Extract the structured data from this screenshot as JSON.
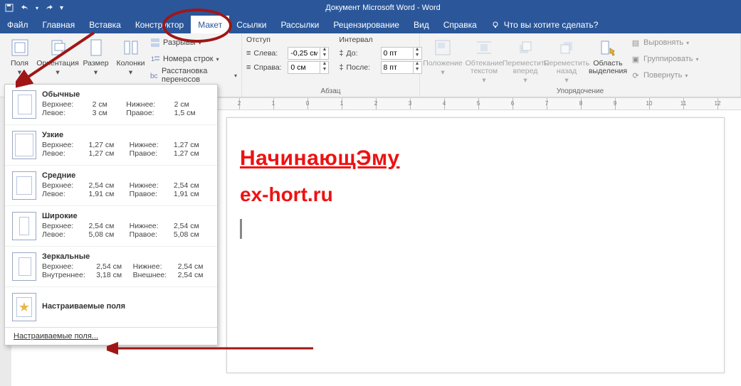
{
  "title": "Документ Microsoft Word  -  Word",
  "qat": {
    "save": "save-icon",
    "undo": "undo-icon",
    "redo": "redo-icon",
    "more": "more-icon"
  },
  "tabs": [
    "Файл",
    "Главная",
    "Вставка",
    "Конструктор",
    "Макет",
    "Ссылки",
    "Рассылки",
    "Рецензирование",
    "Вид",
    "Справка"
  ],
  "active_tab": "Макет",
  "tell_me": "Что вы хотите сделать?",
  "ribbon": {
    "page_setup": {
      "margins": "Поля",
      "orientation": "Ориентация",
      "size": "Размер",
      "columns": "Колонки",
      "breaks": "Разрывы",
      "line_numbers": "Номера строк",
      "hyphenation": "Расстановка переносов"
    },
    "paragraph": {
      "indent_label": "Отступ",
      "spacing_label": "Интервал",
      "left_label": "Слева:",
      "right_label": "Справа:",
      "before_label": "До:",
      "after_label": "После:",
      "left_value": "-0,25 см",
      "right_value": "0 см",
      "before_value": "0 пт",
      "after_value": "8 пт",
      "group_label": "Абзац"
    },
    "arrange": {
      "position": "Положение",
      "wrap": "Обтекание текстом",
      "forward": "Переместить вперед",
      "backward": "Переместить назад",
      "selection_pane": "Область выделения",
      "align": "Выровнять",
      "group": "Группировать",
      "rotate": "Повернуть",
      "group_label": "Упорядочение"
    }
  },
  "margins_menu": {
    "options": [
      {
        "title": "Обычные",
        "top": "2 см",
        "bottom": "2 см",
        "left": "3 см",
        "right": "1,5 см",
        "lk": "Левое:",
        "rk": "Правое:"
      },
      {
        "title": "Узкие",
        "top": "1,27 см",
        "bottom": "1,27 см",
        "left": "1,27 см",
        "right": "1,27 см",
        "lk": "Левое:",
        "rk": "Правое:"
      },
      {
        "title": "Средние",
        "top": "2,54 см",
        "bottom": "2,54 см",
        "left": "1,91 см",
        "right": "1,91 см",
        "lk": "Левое:",
        "rk": "Правое:"
      },
      {
        "title": "Широкие",
        "top": "2,54 см",
        "bottom": "2,54 см",
        "left": "5,08 см",
        "right": "5,08 см",
        "lk": "Левое:",
        "rk": "Правое:"
      },
      {
        "title": "Зеркальные",
        "top": "2,54 см",
        "bottom": "2,54 см",
        "left": "3,18 см",
        "right": "2,54 см",
        "lk": "Внутреннее:",
        "rk": "Внешнее:"
      }
    ],
    "labels": {
      "top": "Верхнее:",
      "bottom": "Нижнее:"
    },
    "custom_title": "Настраиваемые поля",
    "footer": "Настраиваемые поля..."
  },
  "ruler": {
    "start": -2,
    "end": 13
  },
  "document": {
    "heading": "НачинающЭму",
    "sub": "ex-hort.ru"
  }
}
